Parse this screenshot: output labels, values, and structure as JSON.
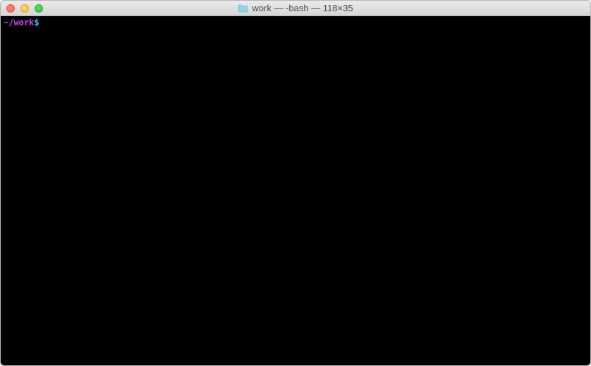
{
  "window": {
    "title": "work — -bash — 118×35"
  },
  "titlebar": {
    "folder_icon_name": "folder-icon",
    "traffic_lights": {
      "close": "close",
      "minimize": "minimize",
      "zoom": "zoom"
    }
  },
  "terminal": {
    "prompt_path": "~/work",
    "prompt_symbol": "$",
    "input_value": "",
    "colors": {
      "background": "#000000",
      "prompt_path": "#d63aff",
      "prompt_symbol": "#2fd0ff",
      "text": "#ffffff"
    }
  }
}
